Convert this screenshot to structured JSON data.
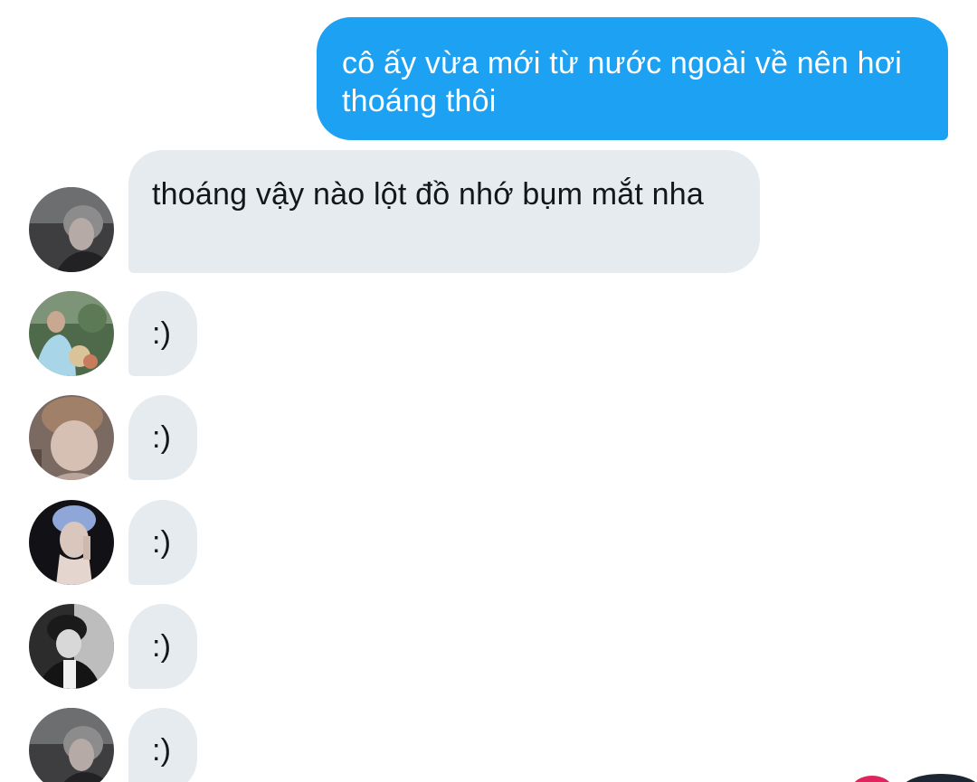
{
  "messages": [
    {
      "direction": "outgoing",
      "text": "cô ấy vừa mới từ nước ngoài về nên hơi thoáng thôi"
    },
    {
      "direction": "incoming",
      "text": "thoáng vậy nào lột đồ nhớ bụm mắt nha",
      "avatar": "member-avatar-1"
    },
    {
      "direction": "incoming",
      "text": ":)",
      "avatar": "member-avatar-2"
    },
    {
      "direction": "incoming",
      "text": ":)",
      "avatar": "member-avatar-3"
    },
    {
      "direction": "incoming",
      "text": ":)",
      "avatar": "member-avatar-4"
    },
    {
      "direction": "incoming",
      "text": ":)",
      "avatar": "member-avatar-5"
    },
    {
      "direction": "incoming",
      "text": ":)",
      "avatar": "member-avatar-1"
    }
  ],
  "colors": {
    "outgoing_bubble": "#1da1f2",
    "incoming_bubble": "#e6ebef",
    "background": "#ffffff"
  }
}
